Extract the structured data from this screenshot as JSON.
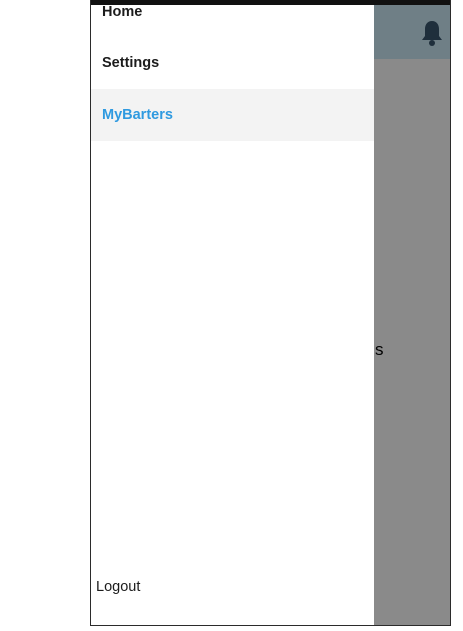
{
  "drawer": {
    "items": [
      {
        "label": "Home"
      },
      {
        "label": "Settings"
      },
      {
        "label": "MyBarters",
        "selected": true
      }
    ],
    "logout_label": "Logout"
  },
  "background": {
    "partial_text": "s",
    "notification_icon": "bell-icon"
  },
  "colors": {
    "selected_text": "#2f9ae0",
    "selected_bg": "#f3f3f3",
    "scrim": "#8a8a8a",
    "header": "#6f7f86"
  }
}
